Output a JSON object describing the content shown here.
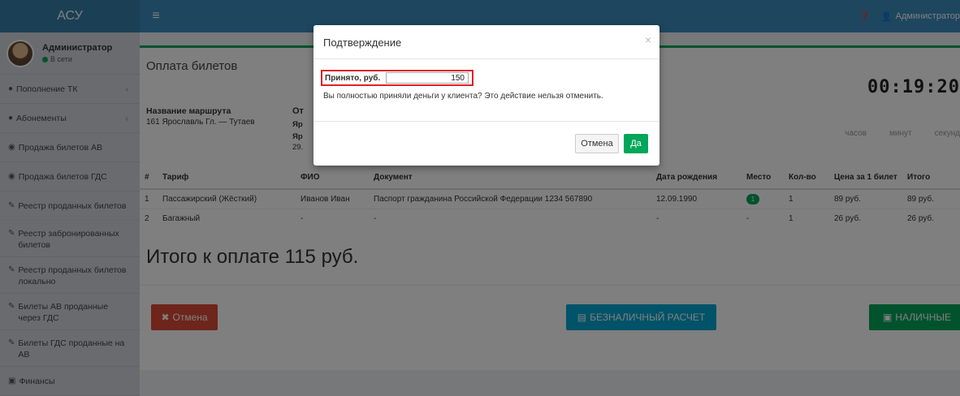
{
  "app": {
    "logo": "АСУ",
    "menu_icon": "hamburger-icon",
    "top_user": "Администратор",
    "help_icon": "question-icon",
    "user_icon": "user-icon"
  },
  "sidebar": {
    "user_name": "Администратор",
    "user_status": "В сети",
    "status_color": "#00a65a",
    "items": [
      {
        "label": "Пополнение ТК",
        "icon": "circle-icon",
        "chevron": "‹"
      },
      {
        "label": "Абонементы",
        "icon": "circle-icon",
        "chevron": "‹"
      },
      {
        "label": "Продажа билетов АВ",
        "icon": "globe-icon"
      },
      {
        "label": "Продажа билетов ГДС",
        "icon": "globe-icon"
      },
      {
        "label": "Реестр проданных билетов",
        "icon": "pencil-icon"
      },
      {
        "label": "Реестр забронированных билетов",
        "icon": "pencil-icon"
      },
      {
        "label": "Реестр проданных билетов локально",
        "icon": "pencil-icon"
      },
      {
        "label": "Билеты АВ проданные через ГДС",
        "icon": "pencil-icon"
      },
      {
        "label": "Билеты ГДС проданные на АВ",
        "icon": "pencil-icon"
      },
      {
        "label": "Финансы",
        "icon": "money-icon"
      }
    ]
  },
  "main": {
    "title": "Оплата билетов",
    "route_label": "Название маршрута",
    "route_value": "161 Ярославль Гл. — Тутаев",
    "peek_head": "От",
    "peek_line1": "Яр",
    "peek_line2": "Яр",
    "peek_line3": "29.",
    "timer": {
      "digits": "00:19:20",
      "labels": [
        "часов",
        "минут",
        "секунд"
      ]
    },
    "table": {
      "headers": [
        "#",
        "Тариф",
        "ФИО",
        "Документ",
        "Дата рождения",
        "Место",
        "Кол-во",
        "Цена за 1 билет",
        "Итого"
      ],
      "rows": [
        [
          "1",
          "Пассажирский (Жёсткий)",
          "Иванов Иван",
          "Паспорт гражданина Российской Федерации 1234 567890",
          "12.09.1990",
          "1",
          "1",
          "89 руб.",
          "89 руб."
        ],
        [
          "2",
          "Багажный",
          "-",
          "-",
          "-",
          "-",
          "1",
          "26 руб.",
          "26 руб."
        ]
      ]
    },
    "total": "Итого к оплате 115 руб.",
    "buttons": {
      "cancel": "Отмена",
      "card": "БЕЗНАЛИЧНЫЙ РАСЧЕТ",
      "cash": "НАЛИЧНЫЕ"
    }
  },
  "modal": {
    "title": "Подтверждение",
    "close": "×",
    "field_label": "Принято, руб.",
    "field_value": "150",
    "message": "Вы полностью приняли деньги у клиента? Это действие нельзя отменить.",
    "cancel": "Отмена",
    "ok": "Да",
    "highlight_color": "#e0202a"
  }
}
